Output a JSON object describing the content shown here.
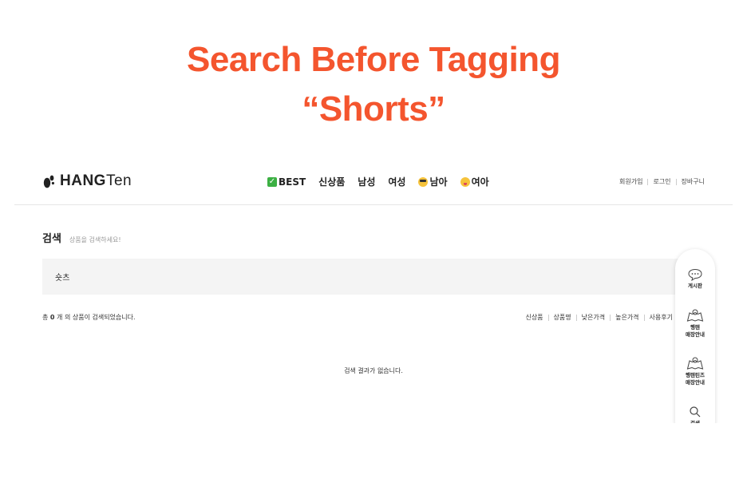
{
  "heading": {
    "line1": "Search Before Tagging",
    "line2": "“Shorts”"
  },
  "colors": {
    "accent": "#f4552e"
  },
  "header": {
    "logo": {
      "icon": "foot-logo-icon",
      "text_bold": "HANG",
      "text_thin": "Ten"
    },
    "nav": [
      {
        "icon": "check-icon",
        "label": "BEST"
      },
      {
        "label": "신상품"
      },
      {
        "label": "남성"
      },
      {
        "label": "여성"
      },
      {
        "icon": "cool-emoji-icon",
        "label": "남아"
      },
      {
        "icon": "tongue-emoji-icon",
        "label": "여아"
      }
    ],
    "util": [
      "회원가입",
      "로그인",
      "장바구니"
    ]
  },
  "search": {
    "title": "검색",
    "subtitle": "상품을 검색하세요!",
    "value": "숏츠",
    "count_prefix": "총",
    "count": "0",
    "count_suffix": "개 의 상품이 검색되었습니다.",
    "sort": [
      "신상품",
      "상품명",
      "낮은가격",
      "높은가격",
      "사용후기"
    ],
    "empty": "검색 결과가 없습니다."
  },
  "quick_menu": [
    {
      "icon": "chat-bubble-icon",
      "line1": "게시판",
      "line2": ""
    },
    {
      "icon": "map-icon",
      "line1": "행텐",
      "line2": "매장안내"
    },
    {
      "icon": "map-icon",
      "line1": "행텐틴즈",
      "line2": "매장안내"
    },
    {
      "icon": "search-icon",
      "line1": "검색",
      "line2": ""
    }
  ]
}
